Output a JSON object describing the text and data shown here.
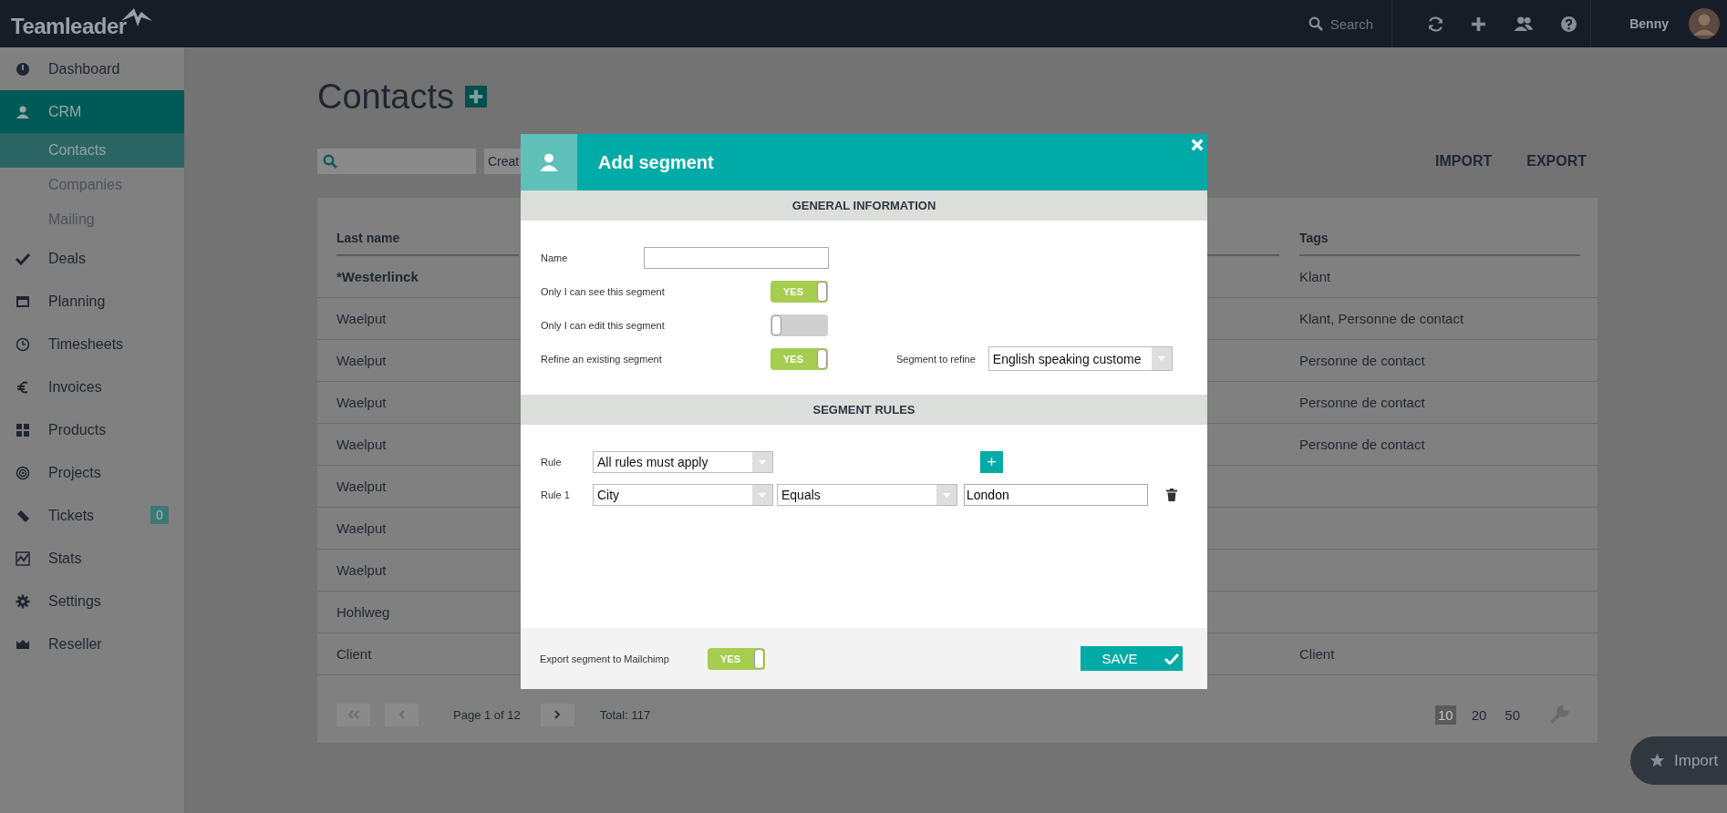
{
  "top_bar": {
    "logo": "Teamleader",
    "search": {
      "placeholder": "Search"
    },
    "user": "Benny"
  },
  "sidebar": {
    "items": [
      {
        "label": "Dashboard",
        "selected": false
      },
      {
        "label": "CRM",
        "selected": true,
        "children": [
          {
            "label": "Contacts",
            "selected": true
          },
          {
            "label": "Companies",
            "selected": false
          },
          {
            "label": "Mailing",
            "selected": false
          }
        ]
      },
      {
        "label": "Deals",
        "selected": false
      },
      {
        "label": "Planning",
        "selected": false
      },
      {
        "label": "Timesheets",
        "selected": false
      },
      {
        "label": "Invoices",
        "selected": false
      },
      {
        "label": "Products",
        "selected": false
      },
      {
        "label": "Projects",
        "selected": false
      },
      {
        "label": "Tickets",
        "selected": false,
        "badge": "0"
      },
      {
        "label": "Stats",
        "selected": false
      },
      {
        "label": "Settings",
        "selected": false
      },
      {
        "label": "Reseller",
        "selected": false
      }
    ]
  },
  "page": {
    "title": "Contacts",
    "create_button": "Creat",
    "actions": [
      "IMPORT",
      "EXPORT"
    ]
  },
  "table": {
    "columns": [
      "Last name",
      "Tags"
    ],
    "rows": [
      {
        "last_name": "*Westerlinck",
        "tags": "Klant",
        "bold": true
      },
      {
        "last_name": "Waelput",
        "tags": "Klant, Personne de contact",
        "bold": false
      },
      {
        "last_name": "Waelput",
        "tags": "Personne de contact",
        "bold": false
      },
      {
        "last_name": "Waelput",
        "tags": "Personne de contact",
        "bold": false
      },
      {
        "last_name": "Waelput",
        "tags": "Personne de contact",
        "bold": false
      },
      {
        "last_name": "Waelput",
        "bold": false
      },
      {
        "last_name": "Waelput",
        "bold": false
      },
      {
        "last_name": "Waelput",
        "bold": false
      },
      {
        "last_name": "Hohlweg",
        "bold": false
      },
      {
        "last_name": "Client",
        "tags": "Client",
        "bold": false
      }
    ]
  },
  "pager": {
    "page": "Page 1 of 12",
    "total": "Total: 117",
    "sizes": [
      {
        "label": "10",
        "selected": true
      },
      {
        "label": "20",
        "selected": false
      },
      {
        "label": "50",
        "selected": false
      }
    ]
  },
  "floating_button": {
    "label": "Import"
  },
  "modal": {
    "title": "Add segment",
    "general": {
      "heading": "GENERAL INFORMATION",
      "fields": [
        {
          "kind": "text",
          "label": "Name"
        },
        {
          "kind": "toggle",
          "label": "Only I can see this segment",
          "on": true,
          "text": "YES"
        },
        {
          "kind": "toggle",
          "label": "Only I can edit this segment",
          "on": false
        },
        {
          "kind": "toggle",
          "label": "Refine an existing segment",
          "on": true,
          "text": "YES",
          "extra": {
            "label": "Segment to refine",
            "value": "English speaking custome"
          }
        }
      ]
    },
    "rules": {
      "heading": "SEGMENT RULES",
      "match": {
        "label": "Rule",
        "value": "All rules must apply",
        "add": "+"
      },
      "items": [
        {
          "label": "Rule 1",
          "field": "City",
          "operator": "Equals",
          "value": "London"
        }
      ]
    },
    "footer": {
      "export": {
        "label": "Export segment to Mailchimp",
        "on": true,
        "text": "YES"
      },
      "save": "SAVE"
    }
  }
}
